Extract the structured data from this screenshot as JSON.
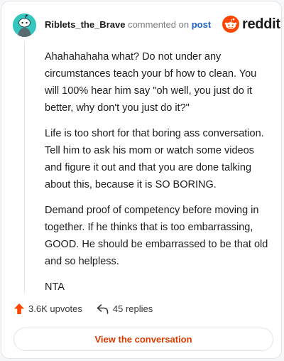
{
  "header": {
    "username": "Riblets_the_Brave",
    "action": "commented on",
    "post_link": "post",
    "logo_text": "reddit"
  },
  "comment": {
    "paragraphs": [
      "Ahahahahaha what? Do not under any circumstances teach your bf how to clean. You will 100% hear him say \"oh well, you just do it better, why don't you just do it?\"",
      "Life is too short for that boring ass conversation. Tell him to ask his mom or watch some videos and figure it out and that you are done talking about this, because it is SO BORING.",
      "Demand proof of competency before moving in together. If he thinks that is too embarrassing, GOOD. He should be embarrassed to be that old and so helpless.",
      "NTA"
    ]
  },
  "stats": {
    "upvotes": "3.6K upvotes",
    "replies": "45 replies"
  },
  "cta": {
    "label": "View the conversation"
  },
  "colors": {
    "accent": "#d93900",
    "reddit_orange": "#ff4500",
    "avatar_bg": "#36c6c0",
    "link": "#1f63c7"
  },
  "icons": [
    "avatar-icon",
    "reddit-logo-icon",
    "upvote-arrow-icon",
    "reply-arrow-icon"
  ]
}
